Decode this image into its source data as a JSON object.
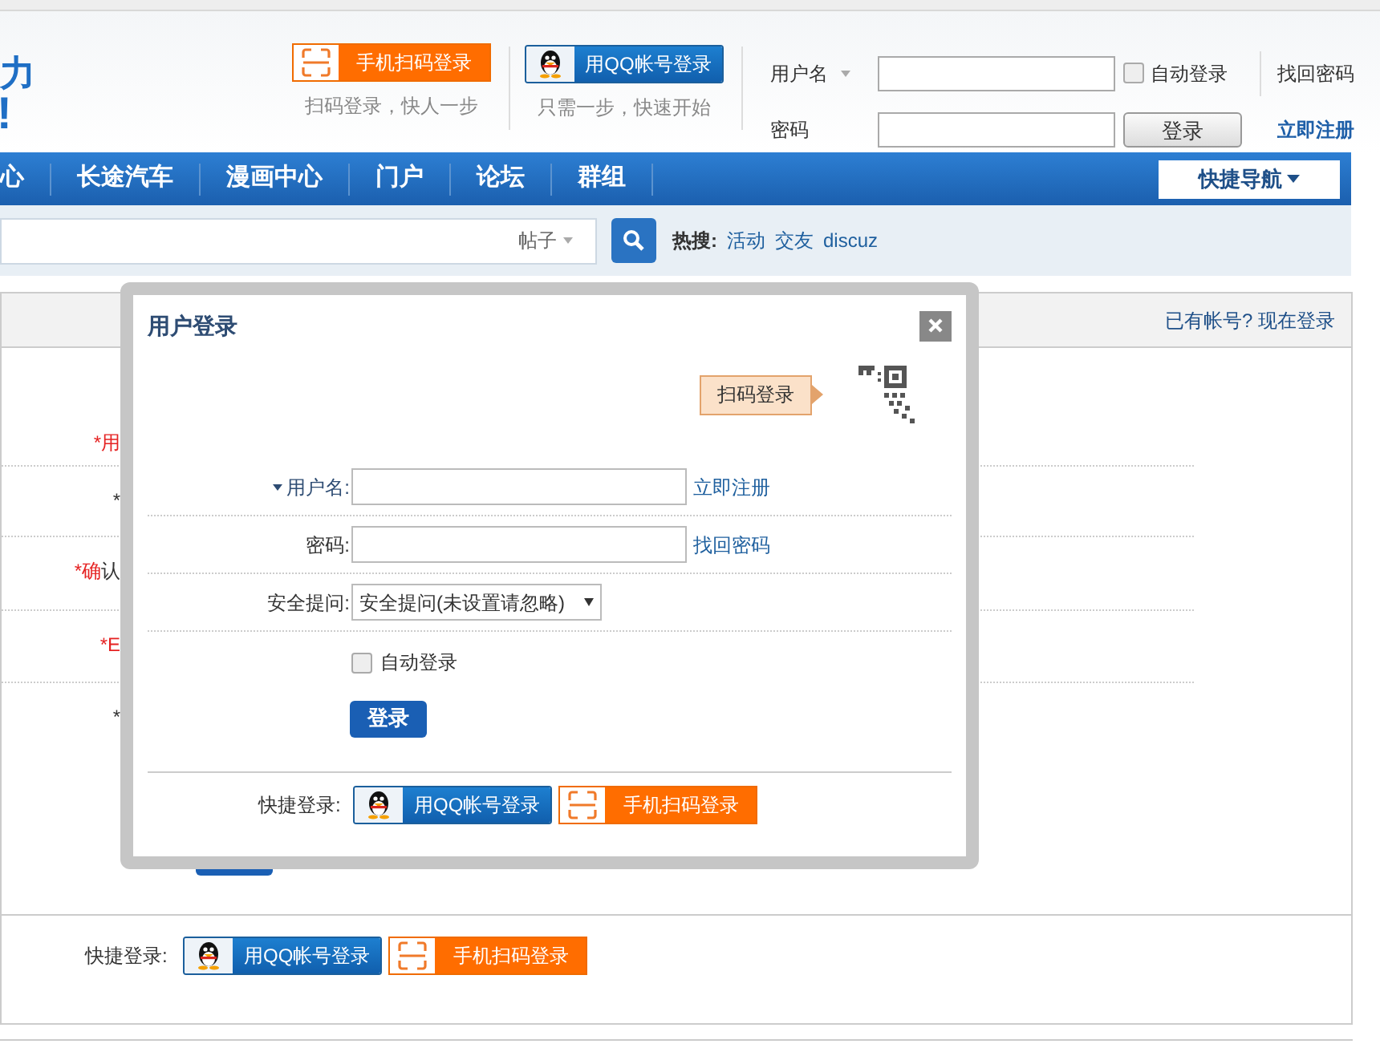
{
  "header": {
    "logo": [
      "力",
      "!"
    ],
    "qr_login": {
      "button": "手机扫码登录",
      "caption": "扫码登录，快人一步"
    },
    "qq_login": {
      "button": "用QQ帐号登录",
      "caption": "只需一步，快速开始"
    },
    "login_form": {
      "username_label": "用户名",
      "password_label": "密码",
      "remember": {
        "label": "自动登录",
        "checked": false
      },
      "submit": "登录",
      "forgot": "找回密码",
      "register": "立即注册"
    }
  },
  "nav": {
    "items": [
      "心",
      "长途汽车",
      "漫画中心",
      "门户",
      "论坛",
      "群组"
    ],
    "quick_nav": "快捷导航"
  },
  "search": {
    "scope": "帖子",
    "hot_label": "热搜:",
    "hot_links": [
      "活动",
      "交友",
      "discuz"
    ]
  },
  "register_panel": {
    "login_link": "已有帐号? 现在登录",
    "field_labels": [
      "*用",
      "*",
      "*确认",
      "*E",
      "*"
    ],
    "quick_login": {
      "label": "快捷登录:",
      "buttons": [
        {
          "kind": "qq",
          "label": "用QQ帐号登录"
        },
        {
          "kind": "qr",
          "label": "手机扫码登录"
        }
      ]
    }
  },
  "login_dialog": {
    "title": "用户登录",
    "qr_tip": "扫码登录",
    "fields": [
      {
        "kind": "text",
        "label": "用户名:",
        "has_caret": true,
        "link": "立即注册"
      },
      {
        "kind": "password",
        "label": "密码:",
        "has_caret": false,
        "link": "找回密码"
      },
      {
        "kind": "select",
        "label": "安全提问:",
        "has_caret": false,
        "value": "安全提问(未设置请忽略)"
      }
    ],
    "remember": {
      "label": "自动登录",
      "checked": false
    },
    "submit": "登录",
    "quick_login": {
      "label": "快捷登录:",
      "buttons": [
        {
          "kind": "qq",
          "label": "用QQ帐号登录"
        },
        {
          "kind": "qr",
          "label": "手机扫码登录"
        }
      ]
    }
  }
}
